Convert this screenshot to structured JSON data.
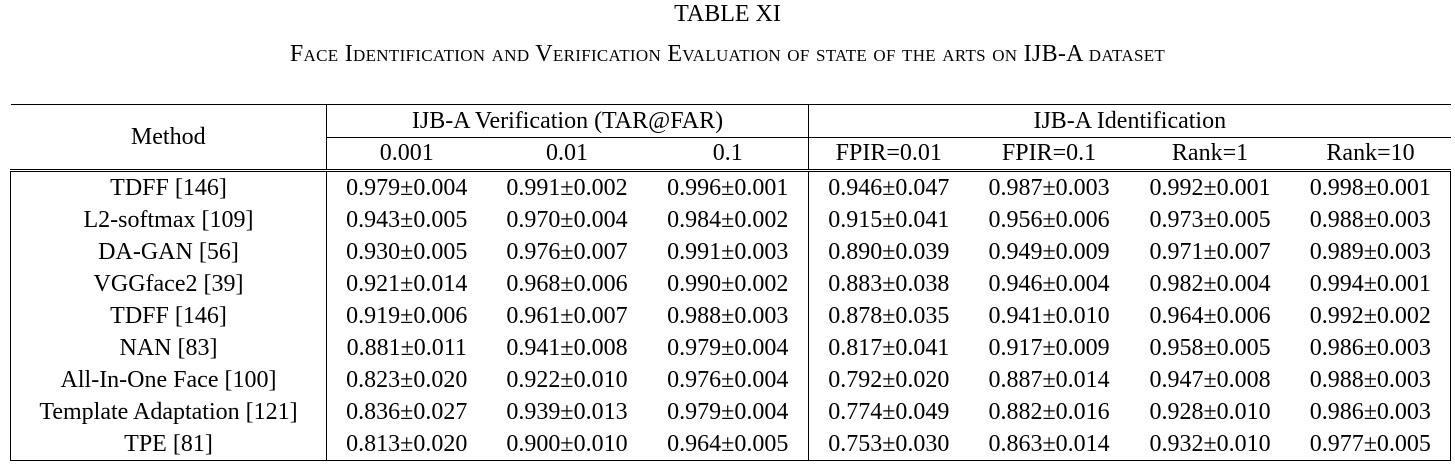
{
  "caption": {
    "title": "TABLE XI",
    "subtitle": "Face Identification and Verification Evaluation of state of the arts on IJB-A dataset"
  },
  "table": {
    "method_header": "Method",
    "group_headers": [
      "IJB-A Verification (TAR@FAR)",
      "IJB-A Identification"
    ],
    "sub_headers": [
      "0.001",
      "0.01",
      "0.1",
      "FPIR=0.01",
      "FPIR=0.1",
      "Rank=1",
      "Rank=10"
    ],
    "rows": [
      {
        "method": "TDFF [146]",
        "values": [
          "0.979±0.004",
          "0.991±0.002",
          "0.996±0.001",
          "0.946±0.047",
          "0.987±0.003",
          "0.992±0.001",
          "0.998±0.001"
        ]
      },
      {
        "method": "L2-softmax [109]",
        "values": [
          "0.943±0.005",
          "0.970±0.004",
          "0.984±0.002",
          "0.915±0.041",
          "0.956±0.006",
          "0.973±0.005",
          "0.988±0.003"
        ]
      },
      {
        "method": "DA-GAN [56]",
        "values": [
          "0.930±0.005",
          "0.976±0.007",
          "0.991±0.003",
          "0.890±0.039",
          "0.949±0.009",
          "0.971±0.007",
          "0.989±0.003"
        ]
      },
      {
        "method": "VGGface2 [39]",
        "values": [
          "0.921±0.014",
          "0.968±0.006",
          "0.990±0.002",
          "0.883±0.038",
          "0.946±0.004",
          "0.982±0.004",
          "0.994±0.001"
        ]
      },
      {
        "method": "TDFF [146]",
        "values": [
          "0.919±0.006",
          "0.961±0.007",
          "0.988±0.003",
          "0.878±0.035",
          "0.941±0.010",
          "0.964±0.006",
          "0.992±0.002"
        ]
      },
      {
        "method": "NAN [83]",
        "values": [
          "0.881±0.011",
          "0.941±0.008",
          "0.979±0.004",
          "0.817±0.041",
          "0.917±0.009",
          "0.958±0.005",
          "0.986±0.003"
        ]
      },
      {
        "method": "All-In-One Face [100]",
        "values": [
          "0.823±0.020",
          "0.922±0.010",
          "0.976±0.004",
          "0.792±0.020",
          "0.887±0.014",
          "0.947±0.008",
          "0.988±0.003"
        ]
      },
      {
        "method": "Template Adaptation [121]",
        "values": [
          "0.836±0.027",
          "0.939±0.013",
          "0.979±0.004",
          "0.774±0.049",
          "0.882±0.016",
          "0.928±0.010",
          "0.986±0.003"
        ]
      },
      {
        "method": "TPE [81]",
        "values": [
          "0.813±0.020",
          "0.900±0.010",
          "0.964±0.005",
          "0.753±0.030",
          "0.863±0.014",
          "0.932±0.010",
          "0.977±0.005"
        ]
      }
    ]
  }
}
